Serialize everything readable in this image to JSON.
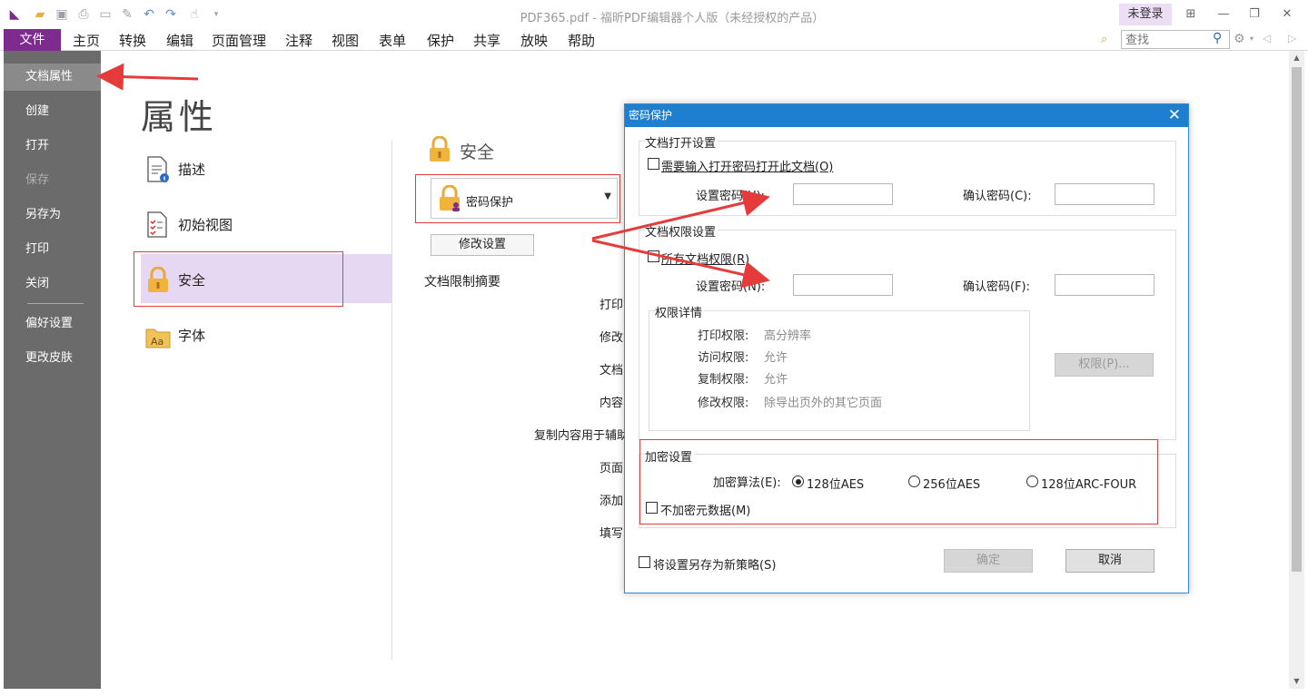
{
  "window": {
    "title": "PDF365.pdf - 福昕PDF编辑器个人版（未经授权的产品）",
    "login_label": "未登录"
  },
  "menubar": {
    "file": "文件",
    "items": [
      "主页",
      "转换",
      "编辑",
      "页面管理",
      "注释",
      "视图",
      "表单",
      "保护",
      "共享",
      "放映",
      "帮助"
    ],
    "search_placeholder": "查找"
  },
  "leftnav": {
    "items": [
      {
        "label": "文档属性",
        "active": true
      },
      {
        "label": "创建"
      },
      {
        "label": "打开"
      },
      {
        "label": "保存",
        "disabled": true
      },
      {
        "label": "另存为"
      },
      {
        "label": "打印"
      },
      {
        "label": "关闭"
      },
      {
        "label": "偏好设置"
      },
      {
        "label": "更改皮肤"
      }
    ]
  },
  "main": {
    "title": "属性",
    "categories": [
      {
        "label": "描述",
        "icon": "document-info-icon"
      },
      {
        "label": "初始视图",
        "icon": "checklist-icon"
      },
      {
        "label": "安全",
        "icon": "lock-icon",
        "selected": true
      },
      {
        "label": "字体",
        "icon": "font-folder-icon"
      }
    ],
    "security": {
      "heading": "安全",
      "method": "密码保护",
      "modify_button": "修改设置",
      "summary_title": "文档限制摘要",
      "summary_rows": [
        "打印",
        "修改",
        "文档",
        "内容",
        "复制内容用于辅助",
        "页面",
        "添加",
        "填写"
      ]
    }
  },
  "dialog": {
    "title": "密码保护",
    "open_group": {
      "title": "文档打开设置",
      "require_checkbox": "需要输入打开密码打开此文档(O)",
      "set_password": "设置密码(U):",
      "confirm_password": "确认密码(C):"
    },
    "perm_group": {
      "title": "文档权限设置",
      "restrict_checkbox": "所有文档权限(R)",
      "set_password": "设置密码(N):",
      "confirm_password": "确认密码(F):",
      "details_title": "权限详情",
      "details": [
        {
          "label": "打印权限:",
          "value": "高分辨率"
        },
        {
          "label": "访问权限:",
          "value": "允许"
        },
        {
          "label": "复制权限:",
          "value": "允许"
        },
        {
          "label": "修改权限:",
          "value": "除导出页外的其它页面"
        }
      ],
      "perm_button": "权限(P)..."
    },
    "encrypt_group": {
      "title": "加密设置",
      "algo_label": "加密算法(E):",
      "options": [
        "128位AES",
        "256位AES",
        "128位ARC-FOUR"
      ],
      "selected": "128位AES",
      "no_metadata": "不加密元数据(M)"
    },
    "save_policy": "将设置另存为新策略(S)",
    "ok": "确定",
    "cancel": "取消"
  },
  "colors": {
    "accent": "#7e2b90",
    "dialog_title": "#1e7fd0",
    "highlight_box": "#e53b3b",
    "nav_bg": "#6b6b6b"
  }
}
